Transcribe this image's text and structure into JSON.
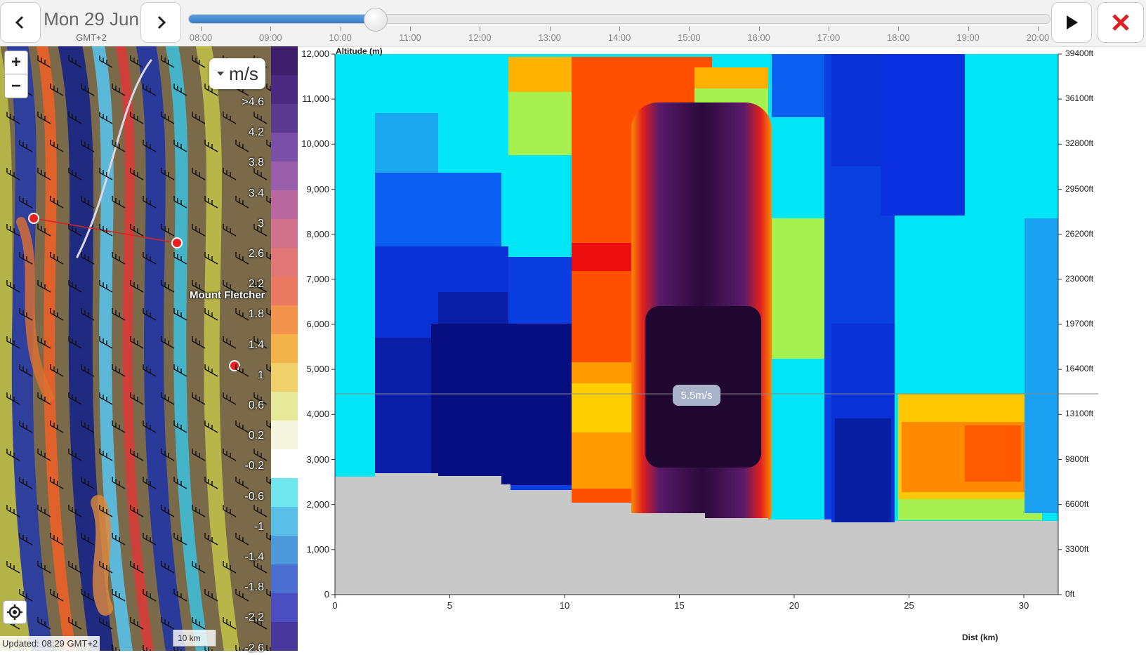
{
  "header": {
    "prev_icon": "chevron-left-icon",
    "next_icon": "chevron-right-icon",
    "date": "Mon 29 Jun",
    "timezone": "GMT+2",
    "play_icon": "play-icon",
    "close_icon": "close-icon",
    "timeline": {
      "ticks": [
        "08:00",
        "09:00",
        "10:00",
        "11:00",
        "12:00",
        "13:00",
        "14:00",
        "15:00",
        "16:00",
        "17:00",
        "18:00",
        "19:00",
        "20:00"
      ],
      "position_fraction": 0.217
    }
  },
  "map": {
    "zoom_in": "+",
    "zoom_out": "−",
    "unit": "m/s",
    "place_name": "Mount Fletcher",
    "updated": "Updated: 08:29 GMT+2",
    "scale": "10 km",
    "legend_labels": [
      ">4.6",
      "4.2",
      "3.8",
      "3.4",
      "3",
      "2.6",
      "2.2",
      "1.8",
      "1.4",
      "1",
      "0.6",
      "0.2",
      "-0.2",
      "-0.6",
      "-1",
      "-1.4",
      "-1.8",
      "-2.2",
      "-2.6"
    ],
    "legend_colors": [
      "#3d1f6b",
      "#4a2a80",
      "#5c3a92",
      "#7a4fa8",
      "#9a5faa",
      "#b8689e",
      "#d0708a",
      "#e07676",
      "#ec7a62",
      "#f2944e",
      "#f4b24a",
      "#f0d06a",
      "#e6e89a",
      "#f6f6e0",
      "#ffffff",
      "#6fe6ee",
      "#59bfe6",
      "#4c98da",
      "#4a6fd0",
      "#4a4ec0",
      "#48389e"
    ]
  },
  "chart": {
    "altitude_label": "Altitude (m)",
    "dist_label": "Dist (km)",
    "y_ticks_m": [
      "12,000",
      "11,000",
      "10,000",
      "9,000",
      "8,000",
      "7,000",
      "6,000",
      "5,000",
      "4,000",
      "3,000",
      "2,000",
      "1,000",
      "0"
    ],
    "y_ticks_ft": [
      "39400ft",
      "36100ft",
      "32800ft",
      "29500ft",
      "26200ft",
      "23000ft",
      "19700ft",
      "16400ft",
      "13100ft",
      "9800ft",
      "6600ft",
      "3300ft",
      "0ft"
    ],
    "x_ticks": [
      "0",
      "5",
      "10",
      "15",
      "20",
      "25",
      "30"
    ],
    "tooltip": "5.5m/s"
  }
}
